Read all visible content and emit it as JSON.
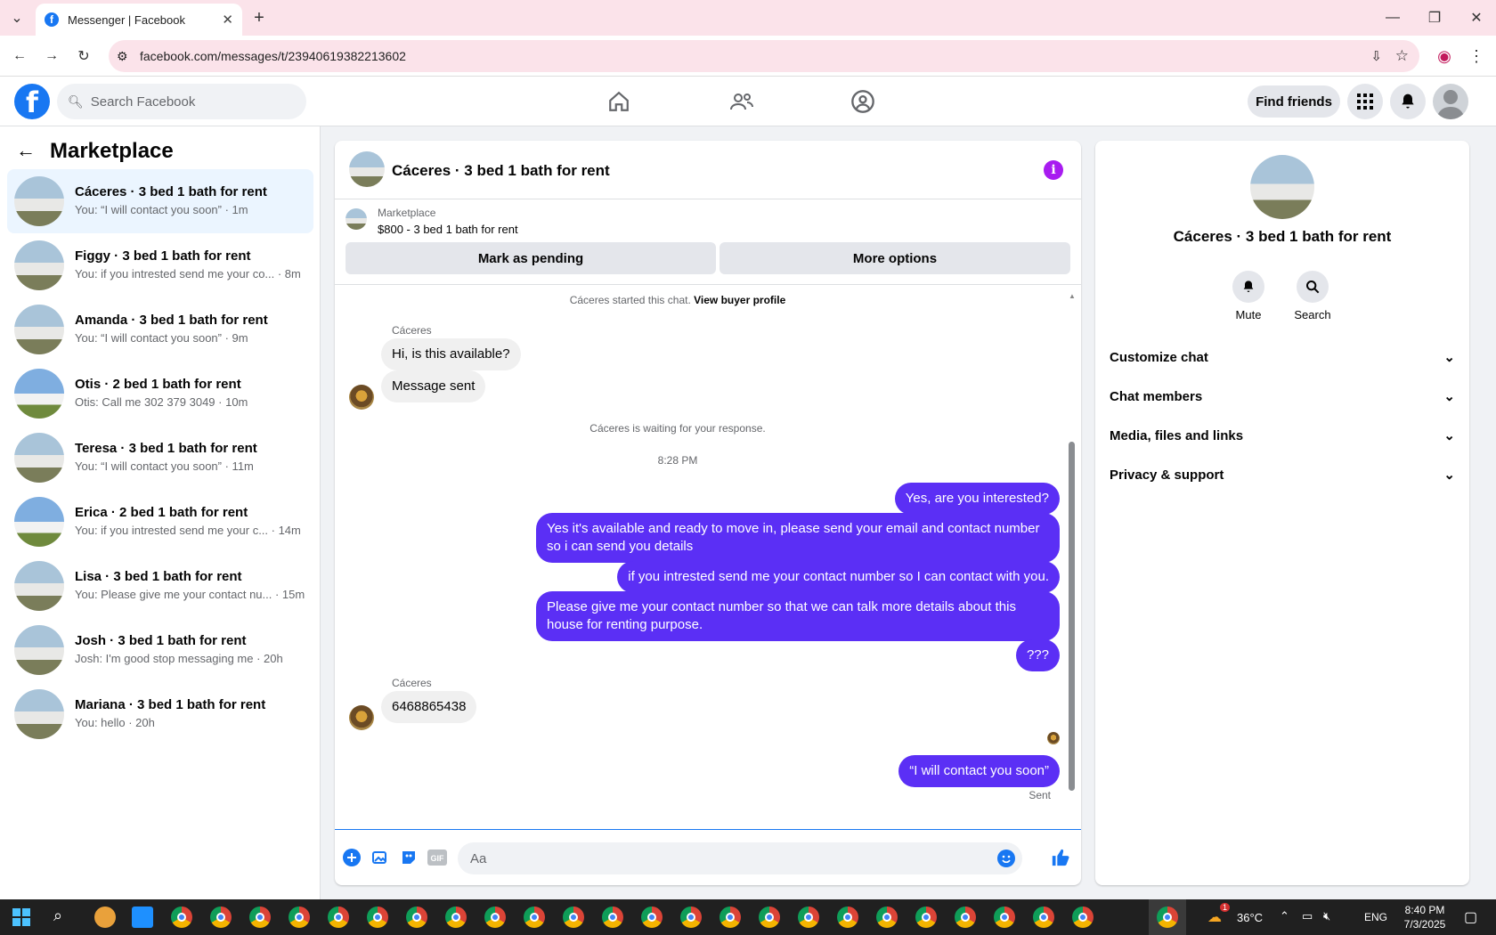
{
  "browser": {
    "tab_title": "Messenger | Facebook",
    "url": "facebook.com/messages/t/23940619382213602"
  },
  "fb": {
    "search_placeholder": "Search Facebook",
    "find_friends": "Find friends"
  },
  "sidebar": {
    "title": "Marketplace",
    "conversations": [
      {
        "name": "Cáceres · 3 bed 1 bath for rent",
        "preview": "You: “I will contact you soon” · 1m"
      },
      {
        "name": "Figgy · 3 bed 1 bath for rent",
        "preview": "You: if you intrested send me your co... · 8m"
      },
      {
        "name": "Amanda · 3 bed 1 bath for rent",
        "preview": "You: “I will contact you soon” · 9m"
      },
      {
        "name": "Otis · 2 bed 1 bath for rent",
        "preview": "Otis: Call me 302 379 3049 · 10m"
      },
      {
        "name": "Teresa · 3 bed 1 bath for rent",
        "preview": "You: “I will contact you soon” · 11m"
      },
      {
        "name": "Erica · 2 bed 1 bath for rent",
        "preview": "You: if you intrested send me your c... · 14m"
      },
      {
        "name": "Lisa · 3 bed 1 bath for rent",
        "preview": "You: Please give me your contact nu... · 15m"
      },
      {
        "name": "Josh · 3 bed 1 bath for rent",
        "preview": "Josh: I'm good stop messaging me · 20h"
      },
      {
        "name": "Mariana · 3 bed 1 bath for rent",
        "preview": "You: hello · 20h"
      }
    ]
  },
  "chat": {
    "title": "Cáceres · 3 bed 1 bath for rent",
    "listing_label": "Marketplace",
    "listing_desc": "$800 - 3 bed 1 bath for rent",
    "mark_pending": "Mark as pending",
    "more_options": "More options",
    "started_text": "Cáceres started this chat.",
    "view_buyer": "View buyer profile",
    "sender_name": "Cáceres",
    "in1": "Hi, is this available?",
    "in2": "Message sent",
    "waiting": "Cáceres is waiting for your response.",
    "time": "8:28 PM",
    "out1": "Yes, are you interested?",
    "out2": "Yes it's available and ready to move in, please send your email and contact number so i can send you details",
    "out3": "if you intrested send me your contact number so I can contact with you.",
    "out4": "Please give me your contact number so that we can talk more details about this house for renting purpose.",
    "out5": "???",
    "in3": "6468865438",
    "out6": "“I will contact you soon”",
    "sent_status": "Sent",
    "input_placeholder": "Aa"
  },
  "panel": {
    "name": "Cáceres · 3 bed 1 bath for rent",
    "mute": "Mute",
    "search": "Search",
    "sections": [
      "Customize chat",
      "Chat members",
      "Media, files and links",
      "Privacy & support"
    ]
  },
  "taskbar": {
    "weather": "36°C",
    "lang": "ENG",
    "time": "8:40 PM",
    "date": "7/3/2025",
    "badge": "1"
  },
  "colors": {
    "fb_blue": "#1877f2",
    "bubble_out": "#5b2ff5",
    "info_purple": "#a81cf0"
  }
}
